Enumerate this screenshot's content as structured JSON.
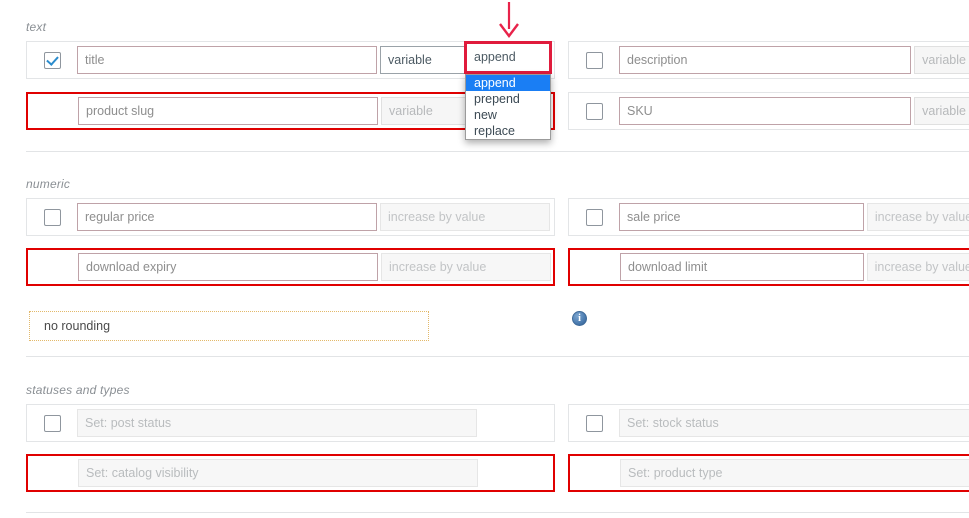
{
  "sections": [
    {
      "label": "text",
      "rows": [
        {
          "checkbox": true,
          "checked": true,
          "flagged": false,
          "field": "title",
          "select": "variable",
          "select_disabled": false,
          "action": "append"
        },
        {
          "checkbox": false,
          "checked": false,
          "flagged": true,
          "field": "product slug",
          "select": "variable",
          "select_disabled": true,
          "action": ""
        },
        {
          "checkbox": true,
          "checked": false,
          "flagged": false,
          "field": "description",
          "select": "variable",
          "select_disabled": true,
          "action": ""
        },
        {
          "checkbox": true,
          "checked": false,
          "flagged": false,
          "field": "SKU",
          "select": "variable",
          "select_disabled": true,
          "action": ""
        }
      ]
    },
    {
      "label": "numeric",
      "rows": [
        {
          "checkbox": true,
          "checked": false,
          "flagged": false,
          "field": "regular price",
          "select": "increase by value"
        },
        {
          "checkbox": false,
          "checked": false,
          "flagged": true,
          "field": "download expiry",
          "select": "increase by value"
        },
        {
          "checkbox": true,
          "checked": false,
          "flagged": false,
          "field": "sale price",
          "select": "increase by value"
        },
        {
          "checkbox": false,
          "checked": false,
          "flagged": true,
          "field": "download limit",
          "select": "increase by value"
        }
      ],
      "rounding": "no rounding",
      "info_icon": "info-icon"
    },
    {
      "label": "statuses and types",
      "rows": [
        {
          "checkbox": true,
          "checked": false,
          "flagged": false,
          "field": "Set: post status"
        },
        {
          "checkbox": false,
          "checked": false,
          "flagged": true,
          "field": "Set: catalog visibility"
        },
        {
          "checkbox": true,
          "checked": false,
          "flagged": false,
          "field": "Set: stock status"
        },
        {
          "checkbox": false,
          "checked": false,
          "flagged": true,
          "field": "Set: product type"
        }
      ]
    }
  ],
  "dropdown": {
    "value": "append",
    "options": [
      "append",
      "prepend",
      "new",
      "replace"
    ],
    "selected_index": 0,
    "highlight_color": "#e01b3c",
    "option_highlight_color": "#1a7ef4"
  },
  "annotation": {
    "arrow": "down-arrow-annotation",
    "color": "#e8234a"
  }
}
